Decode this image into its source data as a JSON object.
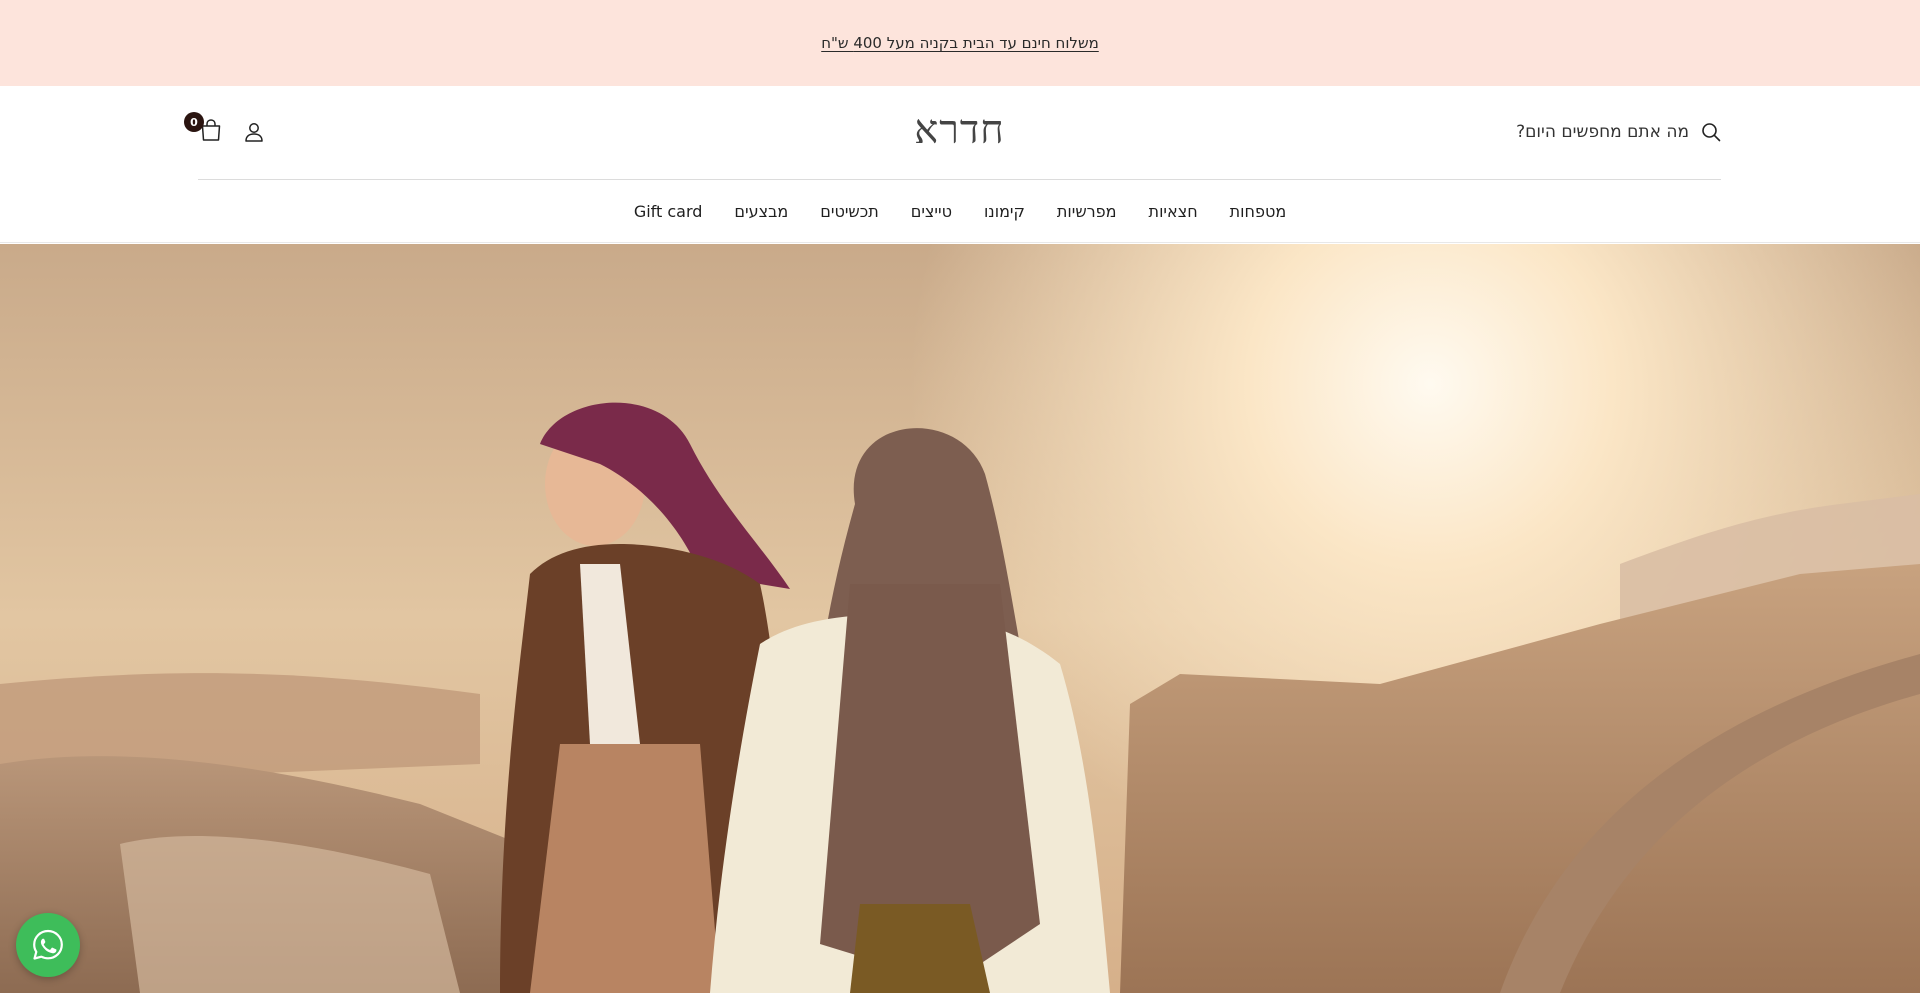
{
  "announcement": {
    "text": "משלוח חינם עד הבית בקניה מעל 400 ש\"ח"
  },
  "header": {
    "search_label": "מה אתם מחפשים היום?",
    "logo_text": "חדרא",
    "cart_count": "0"
  },
  "nav": {
    "items": [
      {
        "label": "מטפחות"
      },
      {
        "label": "חצאיות"
      },
      {
        "label": "מפרשיות"
      },
      {
        "label": "קימונו"
      },
      {
        "label": "טייצים"
      },
      {
        "label": "תכשיטים"
      },
      {
        "label": "מבצעים"
      },
      {
        "label": "Gift card"
      }
    ]
  },
  "icons": {
    "search": "search-icon",
    "account": "account-icon",
    "cart": "shopping-bag-icon",
    "whatsapp": "whatsapp-icon"
  },
  "colors": {
    "announcement_bg": "#fde4dc",
    "cart_badge": "#2a1410",
    "whatsapp": "#3ebd5a"
  }
}
